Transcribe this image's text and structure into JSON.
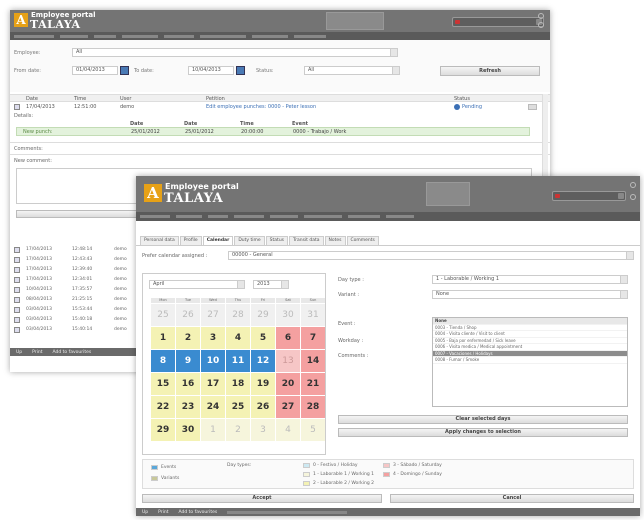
{
  "win1": {
    "app_title": "Employee portal",
    "logo_letter": "A",
    "logo_text": "TALAYA",
    "filters": {
      "employee_label": "Employee:",
      "employee_value": "All",
      "from_label": "From date:",
      "from_value": "01/04/2013",
      "to_label": "To date:",
      "to_value": "10/04/2013",
      "status_label": "Status:",
      "status_value": "All",
      "refresh_label": "Refresh"
    },
    "columns": [
      "Date",
      "Time",
      "User",
      "Petition",
      "Status"
    ],
    "first_row": {
      "date": "17/04/2013",
      "time": "12:51:00",
      "user": "demo",
      "petition": "Edit employee punches: 0000 - Peter lesson",
      "status": "Pending"
    },
    "details_label": "Details:",
    "detail_columns": [
      "Date",
      "Date",
      "Time",
      "Event"
    ],
    "detail_row": {
      "label": "New punch:",
      "date1": "25/01/2012",
      "date2": "25/01/2012",
      "time": "20:00:00",
      "event": "0000 - Trabajo / Work"
    },
    "comments_label": "Comments:",
    "new_comment_label": "New comment:",
    "list_rows": [
      {
        "date": "17/04/2013",
        "time": "12:48:14",
        "user": "demo"
      },
      {
        "date": "17/04/2013",
        "time": "12:43:43",
        "user": "demo"
      },
      {
        "date": "17/04/2013",
        "time": "12:39:40",
        "user": "demo"
      },
      {
        "date": "17/04/2013",
        "time": "12:34:01",
        "user": "demo"
      },
      {
        "date": "10/04/2013",
        "time": "17:35:57",
        "user": "demo"
      },
      {
        "date": "08/04/2013",
        "time": "21:25:15",
        "user": "demo"
      },
      {
        "date": "03/04/2013",
        "time": "15:53:44",
        "user": "demo"
      },
      {
        "date": "03/04/2013",
        "time": "15:40:18",
        "user": "demo"
      },
      {
        "date": "03/04/2013",
        "time": "15:40:14",
        "user": "demo"
      }
    ],
    "footer": {
      "up": "Up",
      "print": "Print",
      "favorites": "Add to favourites"
    }
  },
  "win2": {
    "app_title": "Employee portal",
    "logo_letter": "A",
    "logo_text": "TALAYA",
    "tabs": [
      "Personal data",
      "Profile",
      "Calendar",
      "Duty time",
      "Status",
      "Transit data",
      "Notes",
      "Comments"
    ],
    "active_tab": "Calendar",
    "prefer_label": "Prefer calendar assigned :",
    "prefer_value": "00000 - General",
    "month_value": "April",
    "year_value": "2013",
    "dow": [
      "Mon",
      "Tue",
      "Wed",
      "Thu",
      "Fri",
      "Sat",
      "Sun"
    ],
    "days": [
      {
        "n": "25",
        "c": "grey"
      },
      {
        "n": "26",
        "c": "grey"
      },
      {
        "n": "27",
        "c": "grey"
      },
      {
        "n": "28",
        "c": "grey"
      },
      {
        "n": "29",
        "c": "grey"
      },
      {
        "n": "30",
        "c": "grey"
      },
      {
        "n": "31",
        "c": "grey"
      },
      {
        "n": "1",
        "c": "yellow"
      },
      {
        "n": "2",
        "c": "yellow"
      },
      {
        "n": "3",
        "c": "yellow"
      },
      {
        "n": "4",
        "c": "yellow"
      },
      {
        "n": "5",
        "c": "yellow"
      },
      {
        "n": "6",
        "c": "pink"
      },
      {
        "n": "7",
        "c": "pink"
      },
      {
        "n": "8",
        "c": "blue"
      },
      {
        "n": "9",
        "c": "blue"
      },
      {
        "n": "10",
        "c": "blue"
      },
      {
        "n": "11",
        "c": "blue"
      },
      {
        "n": "12",
        "c": "blue"
      },
      {
        "n": "13",
        "c": "pinkg"
      },
      {
        "n": "14",
        "c": "pink"
      },
      {
        "n": "15",
        "c": "yellow"
      },
      {
        "n": "16",
        "c": "yellow"
      },
      {
        "n": "17",
        "c": "yellow"
      },
      {
        "n": "18",
        "c": "yellow"
      },
      {
        "n": "19",
        "c": "yellow"
      },
      {
        "n": "20",
        "c": "pink"
      },
      {
        "n": "21",
        "c": "pink"
      },
      {
        "n": "22",
        "c": "yellow"
      },
      {
        "n": "23",
        "c": "yellow"
      },
      {
        "n": "24",
        "c": "yellow"
      },
      {
        "n": "25",
        "c": "yellow"
      },
      {
        "n": "26",
        "c": "yellow"
      },
      {
        "n": "27",
        "c": "pink"
      },
      {
        "n": "28",
        "c": "pink"
      },
      {
        "n": "29",
        "c": "yellow"
      },
      {
        "n": "30",
        "c": "yellow"
      },
      {
        "n": "1",
        "c": "cream"
      },
      {
        "n": "2",
        "c": "cream"
      },
      {
        "n": "3",
        "c": "cream"
      },
      {
        "n": "4",
        "c": "cream"
      },
      {
        "n": "5",
        "c": "cream"
      }
    ],
    "day_type_label": "Day type :",
    "day_type_value": "1 - Laborable / Working 1",
    "variant_label": "Variant :",
    "variant_value": "None",
    "event_label": "Event :",
    "workday_label": "Workday :",
    "comments_label": "Comments :",
    "events": [
      {
        "t": "None",
        "s": "head"
      },
      {
        "t": "0003 - Tienda / Shop",
        "s": ""
      },
      {
        "t": "0004 - Visita cliente / Visit to client",
        "s": ""
      },
      {
        "t": "0005 - Baja por enfermedad / Sick leave",
        "s": ""
      },
      {
        "t": "0006 - Visita medica / Medical appointment",
        "s": ""
      },
      {
        "t": "0007 - Vacaciones / Holidays",
        "s": "sel"
      },
      {
        "t": "0008 - Fumar / Smoke",
        "s": ""
      }
    ],
    "clear_label": "Clear selected days",
    "apply_label": "Apply changes to selection",
    "legend": {
      "events": "Events",
      "variants": "Variants",
      "day_types_label": "Day types:",
      "dt0": "0 - Festivo / Holiday",
      "dt1": "1 - Laborable 1 / Working 1",
      "dt2": "2 - Laborable 2 / Working 2",
      "dt3": "3 - Sábado / Saturday",
      "dt4": "4 - Domingo / Sunday"
    },
    "accept_label": "Accept",
    "cancel_label": "Cancel",
    "footer": {
      "up": "Up",
      "print": "Print",
      "favorites": "Add to favourites"
    }
  },
  "colors": {
    "brand": "#e6a117",
    "topbar": "#747474",
    "selected_blue": "#3a8bd0",
    "weekend_pink": "#f4a0a0",
    "workday_yellow": "#f4f2b4"
  }
}
